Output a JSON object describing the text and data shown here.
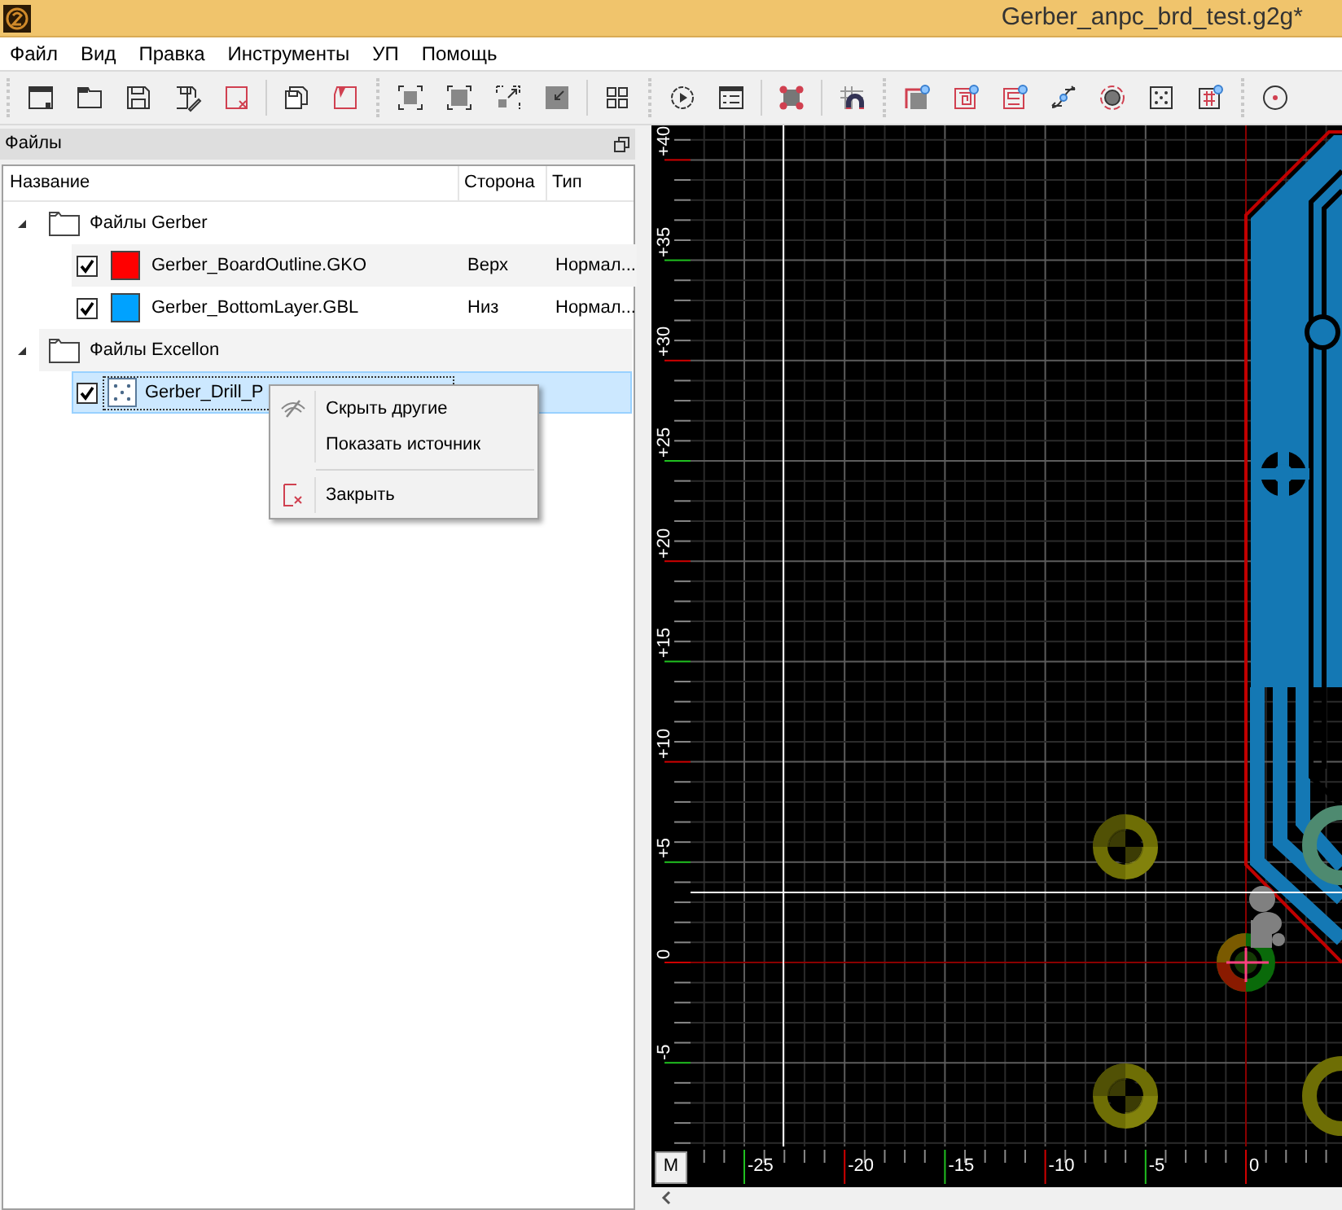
{
  "window": {
    "title": "Gerber_anpc_brd_test.g2g*"
  },
  "menu": [
    "Файл",
    "Вид",
    "Правка",
    "Инструменты",
    "УП",
    "Помощь"
  ],
  "files_panel": {
    "title": "Файлы",
    "columns": [
      "Название",
      "Сторона",
      "Тип"
    ],
    "groups": [
      {
        "label": "Файлы Gerber",
        "expanded": true,
        "children": [
          {
            "kind": "layer",
            "name": "Gerber_BoardOutline.GKO",
            "checked": true,
            "color": "#ff0000",
            "side": "Верх",
            "type": "Нормал...",
            "selected": false
          },
          {
            "kind": "layer",
            "name": "Gerber_BottomLayer.GBL",
            "checked": true,
            "color": "#00a2ff",
            "side": "Низ",
            "type": "Нормал...",
            "selected": false
          }
        ]
      },
      {
        "label": "Файлы Excellon",
        "expanded": true,
        "children": [
          {
            "kind": "drill",
            "name": "Gerber_Drill_P",
            "checked": true,
            "selected": true
          }
        ]
      }
    ]
  },
  "context_menu": {
    "items": [
      {
        "kind": "hide",
        "label": "Скрыть другие"
      },
      {
        "kind": "plain",
        "label": "Показать источник"
      },
      {
        "kind": "separator"
      },
      {
        "kind": "close",
        "label": "Закрыть"
      }
    ]
  },
  "canvas": {
    "vertical_ruler": [
      "+40",
      "+35",
      "+30",
      "+25",
      "+20",
      "+15",
      "+10",
      "+5",
      "0",
      "-5"
    ],
    "horizontal_ruler": [
      "-25",
      "-20",
      "-15",
      "-10",
      "-5",
      "0"
    ],
    "units_button": "M"
  }
}
